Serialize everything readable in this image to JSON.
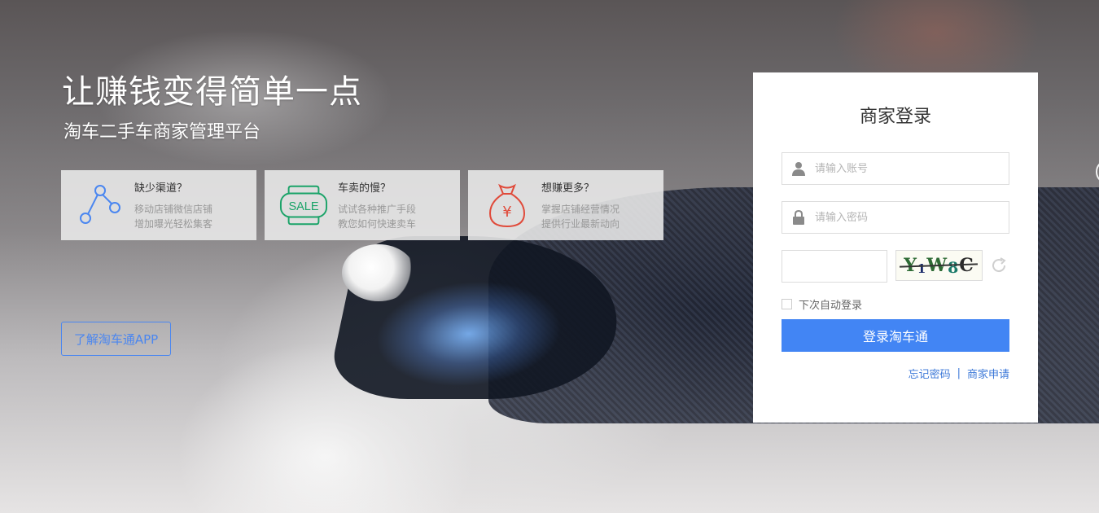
{
  "hero": {
    "title": "让赚钱变得简单一点",
    "subtitle": "淘车二手车商家管理平台"
  },
  "features": [
    {
      "icon": "share-nodes-icon",
      "title": "缺少渠道？",
      "desc1": "移动店铺微信店铺",
      "desc2": "增加曝光轻松集客",
      "color": "#4a86f0"
    },
    {
      "icon": "sale-tag-icon",
      "icon_text": "SALE",
      "title": "车卖的慢？",
      "desc1": "试试各种推广手段",
      "desc2": "教您如何快速卖车",
      "color": "#1aa368"
    },
    {
      "icon": "money-bag-icon",
      "icon_text": "¥",
      "title": "想赚更多？",
      "desc1": "掌握店铺经营情况",
      "desc2": "提供行业最新动向",
      "color": "#e04a3a"
    }
  ],
  "app_button": "了解淘车通APP",
  "login": {
    "title": "商家登录",
    "account_placeholder": "请输入账号",
    "password_placeholder": "请输入密码",
    "captcha": {
      "chars": [
        "Y",
        "1",
        "W",
        "8",
        "C"
      ]
    },
    "remember_label": "下次自动登录",
    "submit_label": "登录淘车通",
    "forgot_label": "忘记密码",
    "separator": "|",
    "apply_label": "商家申请"
  },
  "colors": {
    "accent": "#4285f4",
    "link": "#3c78d8"
  }
}
